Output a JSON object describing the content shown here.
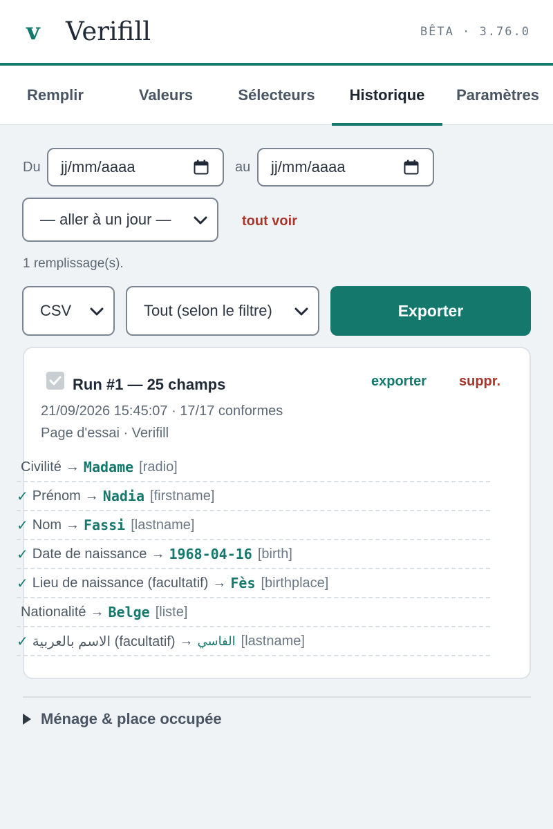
{
  "header": {
    "logo": "v",
    "title": "Verifill",
    "version": "BÊTA · 3.76.0"
  },
  "tabs": [
    {
      "label": "Remplir"
    },
    {
      "label": "Valeurs"
    },
    {
      "label": "Sélecteurs"
    },
    {
      "label": "Historique",
      "active": true
    },
    {
      "label": "Paramètres"
    }
  ],
  "filters": {
    "from_label": "Du",
    "to_label": "au",
    "from_placeholder": "jj/mm/aaaa",
    "to_placeholder": "jj/mm/aaaa",
    "jump_select": "— aller à un jour —",
    "see_all": "tout voir"
  },
  "count_text": "1 remplissage(s).",
  "export": {
    "format": "CSV",
    "scope": "Tout (selon le filtre)",
    "button": "Exporter"
  },
  "run": {
    "title": "Run #1 — 25 champs",
    "checked": true,
    "export_link": "exporter",
    "delete_link": "suppr.",
    "datetime_status": "21/09/2026 15:45:07 · 17/17 conformes",
    "page": "Page d'essai · Verifill",
    "fields": [
      {
        "check": "",
        "label": "Civilité",
        "value": "Madame",
        "tag": "[radio]"
      },
      {
        "check": "✓",
        "label": "Prénom",
        "value": "Nadia",
        "tag": "[firstname]"
      },
      {
        "check": "✓",
        "label": "Nom",
        "value": "Fassi",
        "tag": "[lastname]"
      },
      {
        "check": "✓",
        "label": "Date de naissance",
        "value": "1968-04-16",
        "tag": "[birth]"
      },
      {
        "check": "✓",
        "label": "Lieu de naissance (facultatif)",
        "value": "Fès",
        "tag": "[birthplace]"
      },
      {
        "check": "",
        "label": "Nationalité",
        "value": "Belge",
        "tag": "[liste]"
      },
      {
        "check": "✓",
        "label": "الاسم بالعربية (facultatif)",
        "value": "الفاسي",
        "tag": "[lastname]"
      }
    ]
  },
  "details_summary": "Ménage & place occupée",
  "colors": {
    "accent": "#15786c",
    "danger": "#a8362c",
    "background": "#eff3f6"
  }
}
